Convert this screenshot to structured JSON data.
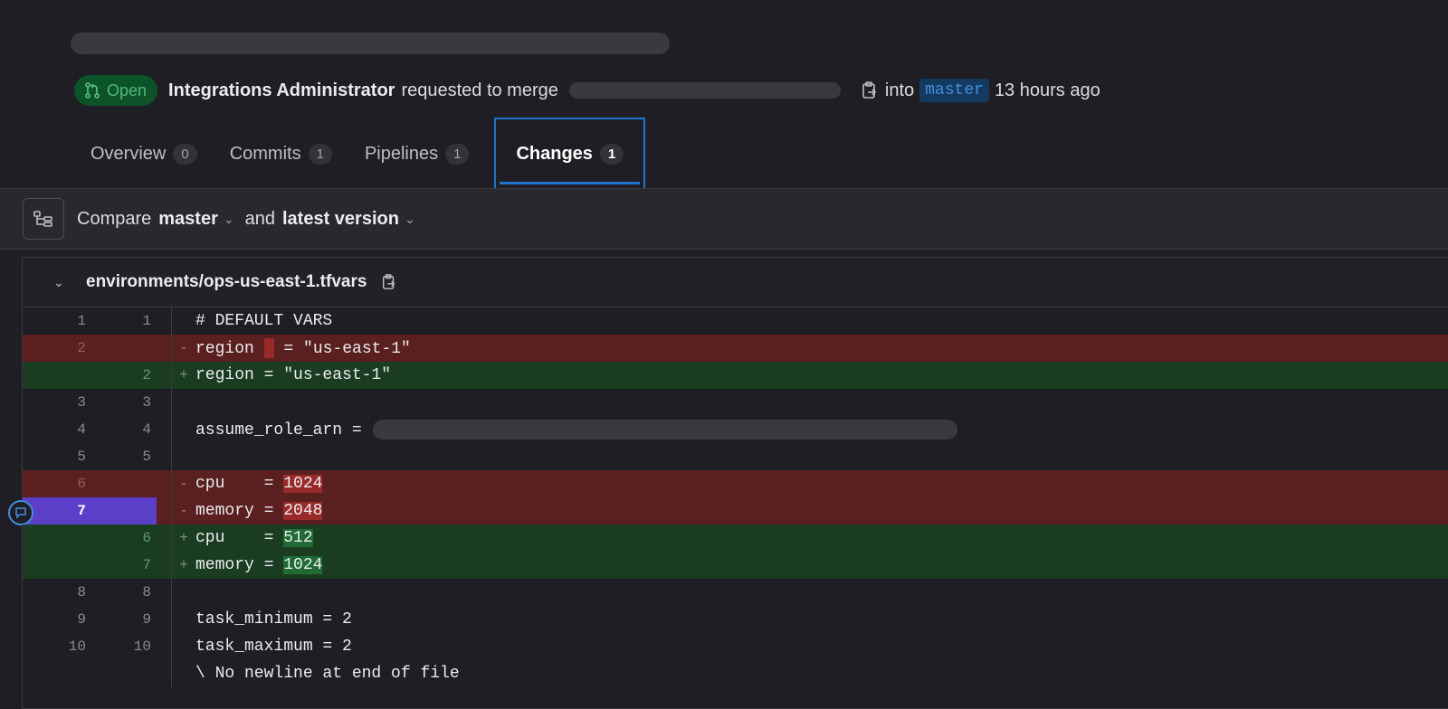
{
  "header": {
    "status_badge": "Open",
    "author": "Integrations Administrator",
    "action_text": "requested to merge",
    "into_text": "into",
    "target_branch": "master",
    "time_ago": "13 hours ago"
  },
  "tabs": [
    {
      "label": "Overview",
      "count": "0"
    },
    {
      "label": "Commits",
      "count": "1"
    },
    {
      "label": "Pipelines",
      "count": "1"
    },
    {
      "label": "Changes",
      "count": "1",
      "active": true
    }
  ],
  "compare": {
    "label": "Compare",
    "base": "master",
    "and_text": "and",
    "head": "latest version"
  },
  "file": {
    "path": "environments/ops-us-east-1.tfvars"
  },
  "diff_lines": [
    {
      "old": "1",
      "new": "1",
      "type": "ctx",
      "code": "# DEFAULT VARS"
    },
    {
      "old": "2",
      "new": "",
      "type": "del",
      "code_pre": "region ",
      "code_post": " = \"us-east-1\""
    },
    {
      "old": "",
      "new": "2",
      "type": "add",
      "code": "region = \"us-east-1\""
    },
    {
      "old": "3",
      "new": "3",
      "type": "ctx",
      "code": ""
    },
    {
      "old": "4",
      "new": "4",
      "type": "ctx",
      "code": "assume_role_arn ="
    },
    {
      "old": "5",
      "new": "5",
      "type": "ctx",
      "code": ""
    },
    {
      "old": "6",
      "new": "",
      "type": "del",
      "code_pre": "cpu    = ",
      "code_hl": "1024"
    },
    {
      "old": "7",
      "new": "",
      "type": "del",
      "code_pre": "memory = ",
      "code_hl": "2048"
    },
    {
      "old": "",
      "new": "6",
      "type": "add",
      "code_pre": "cpu    = ",
      "code_hl": "512"
    },
    {
      "old": "",
      "new": "7",
      "type": "add",
      "code_pre": "memory = ",
      "code_hl": "1024"
    },
    {
      "old": "8",
      "new": "8",
      "type": "ctx",
      "code": ""
    },
    {
      "old": "9",
      "new": "9",
      "type": "ctx",
      "code": "task_minimum = 2"
    },
    {
      "old": "10",
      "new": "10",
      "type": "ctx",
      "code": "task_maximum = 2"
    },
    {
      "old": "",
      "new": "",
      "type": "ctx",
      "code": "\\ No newline at end of file"
    }
  ],
  "signs": {
    "del": "-",
    "add": "+"
  },
  "colors": {
    "accent": "#1f75cb",
    "deleted_bg": "#5a1f1f",
    "added_bg": "#1a3d22",
    "selected_line": "#5b3fc9",
    "open_badge": "#0d532a"
  }
}
